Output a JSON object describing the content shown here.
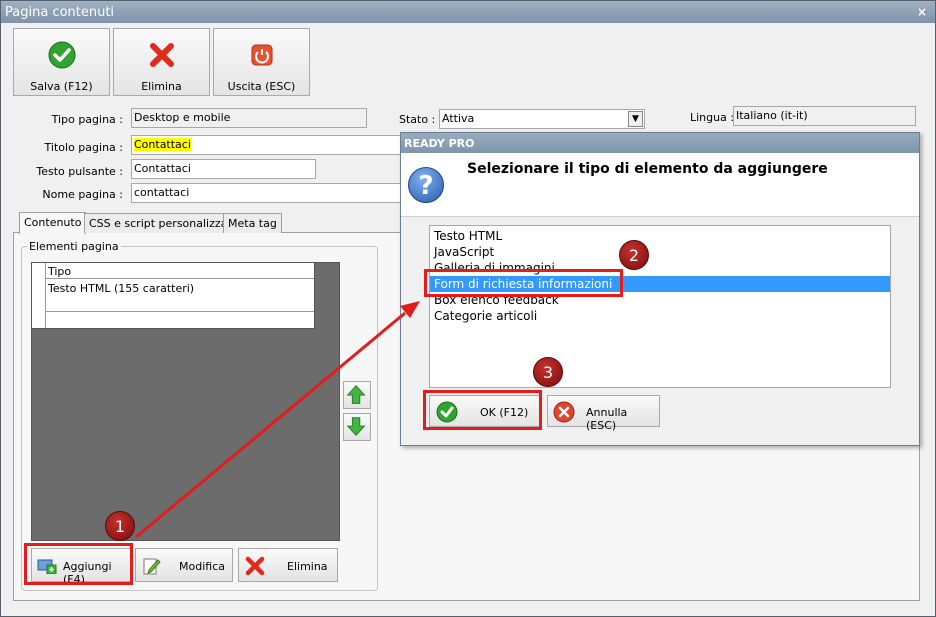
{
  "window": {
    "title": "Pagina contenuti",
    "close_glyph": "×"
  },
  "toolbar": {
    "save_label": "Salva (F12)",
    "delete_label": "Elimina",
    "exit_label": "Uscita (ESC)"
  },
  "form": {
    "page_type_label": "Tipo pagina :",
    "page_type_value": "Desktop e mobile",
    "status_label": "Stato :",
    "status_value": "Attiva",
    "language_label": "Lingua :",
    "language_value": "Italiano (it-it)",
    "page_title_label": "Titolo pagina :",
    "page_title_value": "Contattaci",
    "button_text_label": "Testo pulsante :",
    "button_text_value": "Contattaci",
    "page_name_label": "Nome pagina :",
    "page_name_value": "contattaci"
  },
  "tabs": [
    {
      "label": "Contenuto"
    },
    {
      "label": "CSS e script personalizzati"
    },
    {
      "label": "Meta tag"
    }
  ],
  "elements": {
    "group_label": "Elementi pagina",
    "column_header": "Tipo",
    "rows": [
      "Testo HTML (155 caratteri)"
    ],
    "add_label": "Aggiungi (F4)",
    "edit_label": "Modifica",
    "delete_label": "Elimina"
  },
  "dialog": {
    "title": "READY PRO",
    "question_glyph": "?",
    "message": "Selezionare il tipo di elemento da aggiungere",
    "options": [
      "Testo HTML",
      "JavaScript",
      "Galleria di immagini",
      "Form di richiesta informazioni",
      "Box elenco feedback",
      "Categorie articoli"
    ],
    "selected_option": "Form di richiesta informazioni",
    "ok_label": "OK (F12)",
    "cancel_label": "Annulla (ESC)"
  },
  "annotations": {
    "step1": "1",
    "step2": "2",
    "step3": "3"
  },
  "colors": {
    "highlight": "#ffff00",
    "selection": "#3399ff",
    "annotation_red": "#e51c1c"
  },
  "icons": {
    "save": "green-check-icon",
    "delete": "red-x-icon",
    "exit": "power-icon",
    "add": "add-element-icon",
    "edit": "edit-pencil-icon",
    "move_up": "arrow-up-icon",
    "move_down": "arrow-down-icon",
    "question": "question-icon"
  }
}
